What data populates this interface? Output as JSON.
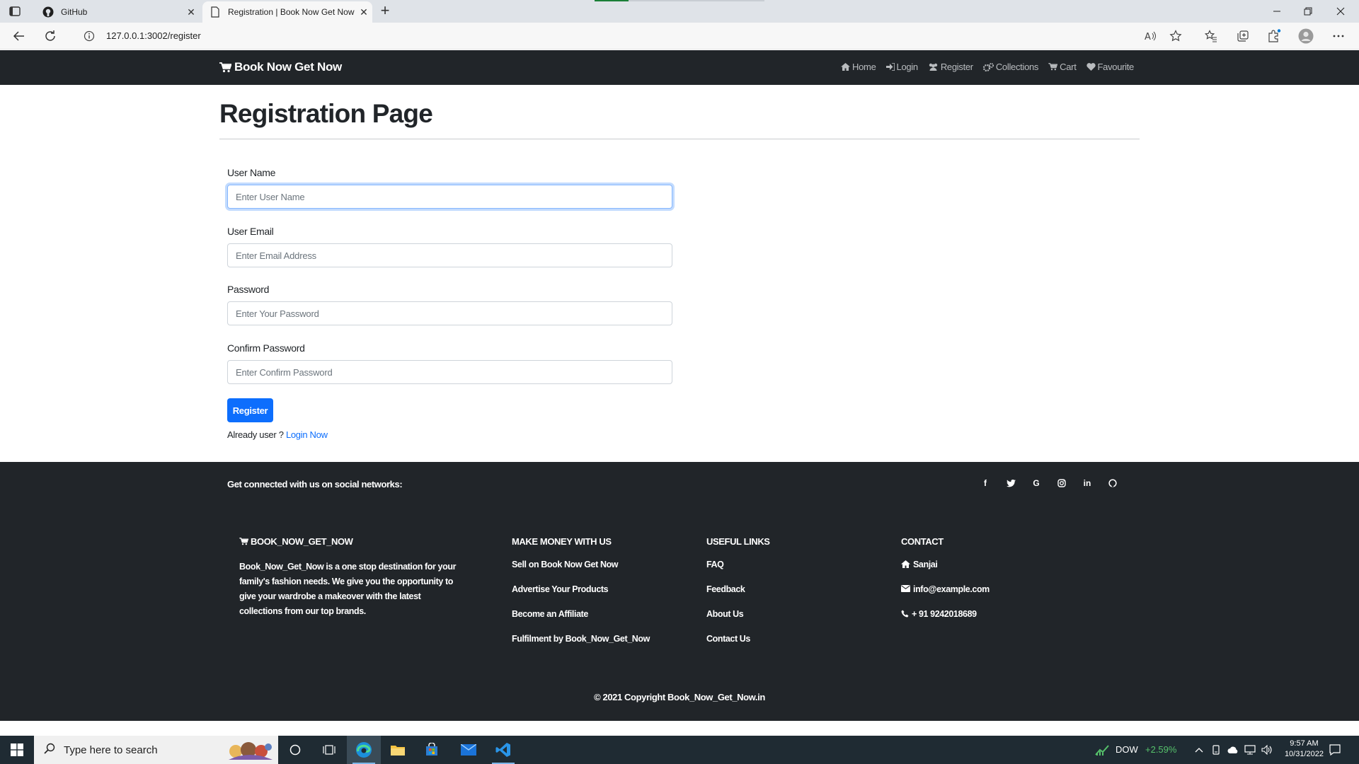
{
  "browser": {
    "tabs": [
      {
        "title": "GitHub",
        "active": false
      },
      {
        "title": "Registration | Book Now Get Now",
        "active": true
      }
    ],
    "url": "127.0.0.1:3002/register"
  },
  "navbar": {
    "brand": "Book Now Get Now",
    "links": [
      {
        "label": "Home",
        "icon": "home-icon"
      },
      {
        "label": "Login",
        "icon": "sign-in-icon"
      },
      {
        "label": "Register",
        "icon": "users-icon"
      },
      {
        "label": "Collections",
        "icon": "cogs-icon"
      },
      {
        "label": "Cart",
        "icon": "cart-icon"
      },
      {
        "label": "Favourite",
        "icon": "heart-icon"
      }
    ]
  },
  "page": {
    "title": "Registration Page"
  },
  "form": {
    "username_label": "User Name",
    "username_placeholder": "Enter User Name",
    "email_label": "User Email",
    "email_placeholder": "Enter Email Address",
    "password_label": "Password",
    "password_placeholder": "Enter Your Password",
    "confirm_label": "Confirm Password",
    "confirm_placeholder": "Enter Confirm Password",
    "submit_label": "Register",
    "already_text": "Already user ? ",
    "login_link": "Login Now"
  },
  "footer": {
    "social_text": "Get connected with us on social networks:",
    "social_icons": [
      "facebook-icon",
      "twitter-icon",
      "google-icon",
      "instagram-icon",
      "linkedin-icon",
      "github-icon"
    ],
    "about": {
      "heading": "BOOK_NOW_GET_NOW",
      "description": "Book_Now_Get_Now is a one stop destination for your family's fashion needs. We give you the opportunity to give your wardrobe a makeover with the latest collections from our top brands."
    },
    "money": {
      "heading": "MAKE MONEY WITH US",
      "links": [
        "Sell on Book Now Get Now",
        "Advertise Your Products",
        "Become an Affiliate",
        "Fulfilment by Book_Now_Get_Now"
      ]
    },
    "useful": {
      "heading": "USEFUL LINKS",
      "links": [
        "FAQ",
        "Feedback",
        "About Us",
        "Contact Us"
      ]
    },
    "contact": {
      "heading": "CONTACT",
      "name": "Sanjai",
      "email": "info@example.com",
      "phone": "+ 91 9242018689"
    },
    "copyright": "© 2021 Copyright Book_Now_Get_Now.in"
  },
  "taskbar": {
    "search_placeholder": "Type here to search",
    "stock_name": "DOW",
    "stock_change": "+2.59%",
    "time": "9:57 AM",
    "date": "10/31/2022"
  },
  "colors": {
    "navbar_bg": "#212529",
    "primary": "#0d6efd",
    "footer_bg": "#212529"
  }
}
